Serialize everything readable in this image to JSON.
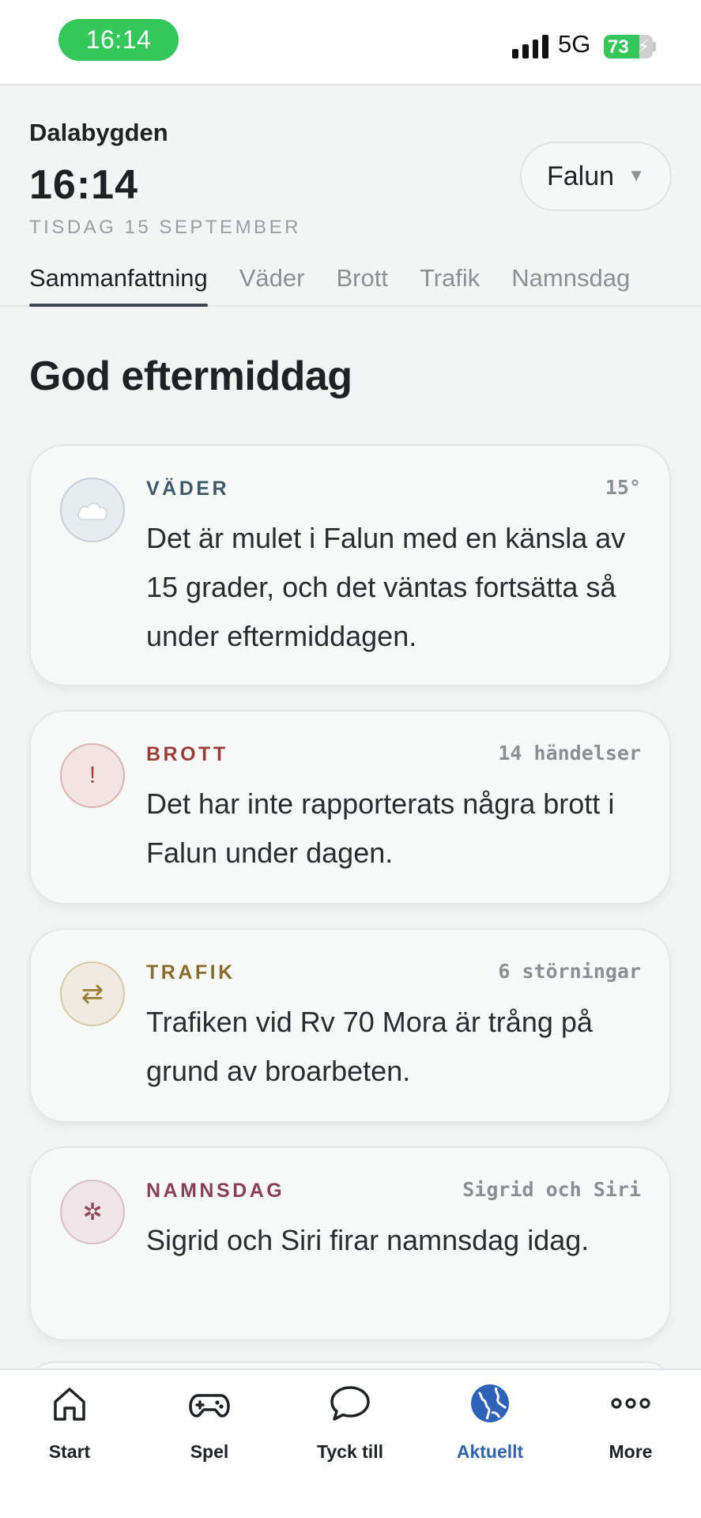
{
  "status_bar": {
    "time": "16:14",
    "network": "5G",
    "battery_percent": "73",
    "battery_level": 0.73
  },
  "header": {
    "region": "Dalabygden",
    "clock": "16:14",
    "date": "TISDAG 15 SEPTEMBER",
    "city_select": {
      "value": "Falun"
    },
    "tabs": [
      {
        "label": "Sammanfattning",
        "active": true
      },
      {
        "label": "Väder"
      },
      {
        "label": "Brott"
      },
      {
        "label": "Trafik"
      },
      {
        "label": "Namnsdag"
      }
    ]
  },
  "main": {
    "greeting": "God eftermiddag",
    "cards": {
      "weather": {
        "icon": "cloud-icon",
        "label": "VÄDER",
        "meta": "15°",
        "text": "Det är mulet i Falun med en känsla av 15 grader, och det väntas fortsätta så under eftermiddagen."
      },
      "crime": {
        "icon": "exclamation-icon",
        "label": "BROTT",
        "meta": "14 händelser",
        "text": "Det har inte rapporterats några brott i Falun under dagen."
      },
      "traffic": {
        "icon": "swap-arrows-icon",
        "label": "TRAFIK",
        "meta": "6 störningar",
        "text": "Trafiken vid Rv 70 Mora är trång på grund av broarbeten."
      },
      "nameday": {
        "icon": "flower-icon",
        "label": "NAMNSDAG",
        "meta": "Sigrid och Siri",
        "text": "Sigrid och Siri firar namnsdag idag."
      }
    }
  },
  "bottom_nav": {
    "items": [
      {
        "label": "Start",
        "icon": "home-icon"
      },
      {
        "label": "Spel",
        "icon": "gamepad-icon"
      },
      {
        "label": "Tyck till",
        "icon": "speech-bubble-icon"
      },
      {
        "label": "Aktuellt",
        "icon": "globe-icon",
        "active": true
      },
      {
        "label": "More",
        "icon": "more-dots-icon"
      }
    ]
  },
  "colors": {
    "accent_blue": "#2e62b8",
    "status_green": "#34c759",
    "weather": "#3c5a6c",
    "crime": "#9c3e37",
    "traffic": "#8a6d2a",
    "nameday": "#8a3e57"
  }
}
